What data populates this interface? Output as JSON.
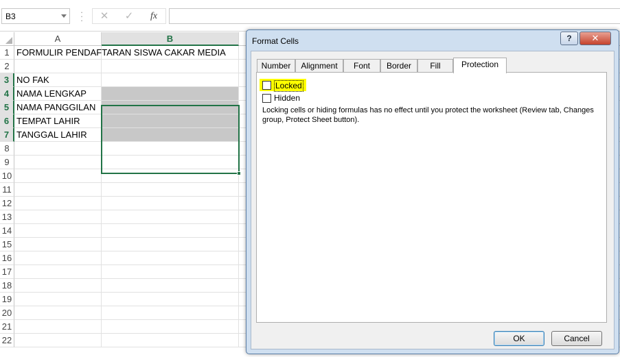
{
  "formula_bar": {
    "name_box": "B3",
    "cancel_icon": "✕",
    "enter_icon": "✓",
    "fx_label": "fx",
    "formula": ""
  },
  "columns": [
    "A",
    "B"
  ],
  "selected_column": "B",
  "rows": [
    {
      "num": "1",
      "a": "FORMULIR PENDAFTARAN SISWA CAKAR MEDIA",
      "b": ""
    },
    {
      "num": "2",
      "a": "",
      "b": ""
    },
    {
      "num": "3",
      "a": "NO FAK",
      "b": ""
    },
    {
      "num": "4",
      "a": "NAMA LENGKAP",
      "b": ""
    },
    {
      "num": "5",
      "a": "NAMA PANGGILAN",
      "b": ""
    },
    {
      "num": "6",
      "a": "TEMPAT LAHIR",
      "b": ""
    },
    {
      "num": "7",
      "a": "TANGGAL LAHIR",
      "b": ""
    },
    {
      "num": "8",
      "a": "",
      "b": ""
    },
    {
      "num": "9",
      "a": "",
      "b": ""
    },
    {
      "num": "10",
      "a": "",
      "b": ""
    },
    {
      "num": "11",
      "a": "",
      "b": ""
    },
    {
      "num": "12",
      "a": "",
      "b": ""
    },
    {
      "num": "13",
      "a": "",
      "b": ""
    },
    {
      "num": "14",
      "a": "",
      "b": ""
    },
    {
      "num": "15",
      "a": "",
      "b": ""
    },
    {
      "num": "16",
      "a": "",
      "b": ""
    },
    {
      "num": "17",
      "a": "",
      "b": ""
    },
    {
      "num": "18",
      "a": "",
      "b": ""
    },
    {
      "num": "19",
      "a": "",
      "b": ""
    },
    {
      "num": "20",
      "a": "",
      "b": ""
    },
    {
      "num": "21",
      "a": "",
      "b": ""
    },
    {
      "num": "22",
      "a": "",
      "b": ""
    }
  ],
  "dialog": {
    "title": "Format Cells",
    "help_label": "?",
    "close_label": "✕",
    "tabs": [
      "Number",
      "Alignment",
      "Font",
      "Border",
      "Fill",
      "Protection"
    ],
    "active_tab": "Protection",
    "locked_label": "Locked",
    "locked_checked": false,
    "hidden_label": "Hidden",
    "hidden_checked": false,
    "note": "Locking cells or hiding formulas has no effect until you protect the worksheet (Review tab, Changes group, Protect Sheet button).",
    "ok_label": "OK",
    "cancel_label": "Cancel"
  },
  "colors": {
    "excel_green": "#217346",
    "gray_fill": "#c8c8c8",
    "highlight": "#ffff00",
    "dialog_frame": "#cfdff0",
    "close_red": "#c5432d"
  }
}
